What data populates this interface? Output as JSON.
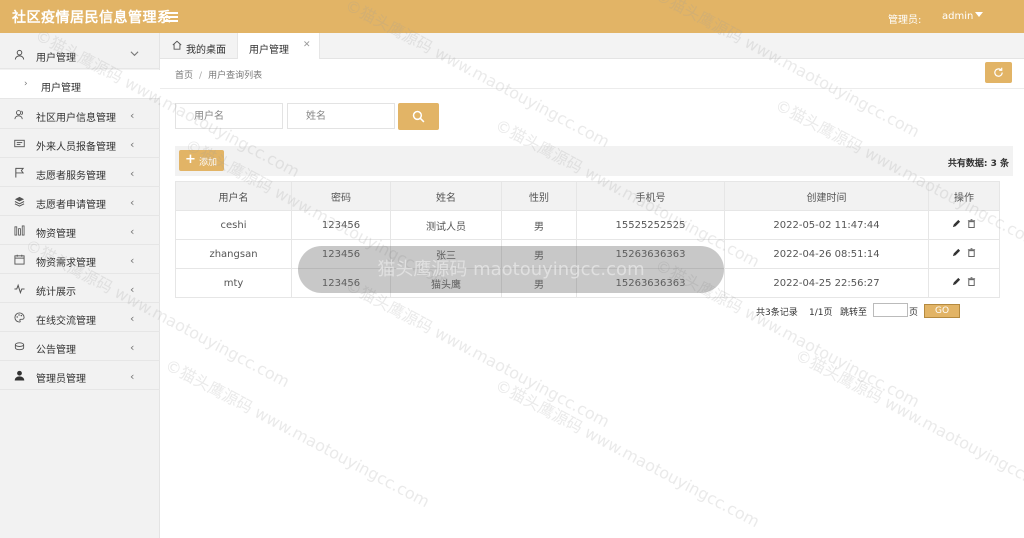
{
  "app": {
    "title": "社区疫情居民信息管理系",
    "admin_label": "管理员:",
    "admin_name": "admin"
  },
  "sidebar": {
    "items": [
      {
        "label": "用户管理",
        "icon": "user-icon",
        "expanded": true
      },
      {
        "label": "社区用户信息管理",
        "icon": "users-icon"
      },
      {
        "label": "外来人员报备管理",
        "icon": "id-card-icon"
      },
      {
        "label": "志愿者服务管理",
        "icon": "flag-icon"
      },
      {
        "label": "志愿者申请管理",
        "icon": "layers-icon"
      },
      {
        "label": "物资管理",
        "icon": "bars-icon"
      },
      {
        "label": "物资需求管理",
        "icon": "calendar-icon"
      },
      {
        "label": "统计展示",
        "icon": "pulse-icon"
      },
      {
        "label": "在线交流管理",
        "icon": "palette-icon"
      },
      {
        "label": "公告管理",
        "icon": "coins-icon"
      },
      {
        "label": "管理员管理",
        "icon": "person-icon"
      }
    ],
    "sub_items": [
      {
        "label": "用户管理"
      }
    ]
  },
  "tabs": {
    "home": "我的桌面",
    "active": "用户管理"
  },
  "breadcrumb": {
    "home": "首页",
    "separator": "/",
    "current": "用户查询列表"
  },
  "search": {
    "username_placeholder": "用户名",
    "name_placeholder": "姓名"
  },
  "toolbar": {
    "add_label": "添加",
    "total_label": "共有数据: 3 条"
  },
  "table": {
    "headers": [
      "用户名",
      "密码",
      "姓名",
      "性别",
      "手机号",
      "创建时间",
      "操作"
    ],
    "rows": [
      [
        "ceshi",
        "123456",
        "测试人员",
        "男",
        "15525252525",
        "2022-05-02 11:47:44"
      ],
      [
        "zhangsan",
        "123456",
        "张三",
        "男",
        "15263636363",
        "2022-04-26 08:51:14"
      ],
      [
        "mty",
        "123456",
        "猫头鹰",
        "男",
        "15263636363",
        "2022-04-25 22:56:27"
      ]
    ]
  },
  "pager": {
    "records": "共3条记录",
    "pages": "1/1页",
    "jump_to": "跳转至",
    "page_unit": "页",
    "go": "GO"
  },
  "watermark": {
    "tile_text": "©猫头鹰源码 www.maotouyingcc.com",
    "banner_text": "猫头鹰源码 maotouyingcc.com"
  },
  "colors": {
    "accent": "#e2b466",
    "sidebar_bg": "#f2f2f2",
    "header_bg": "#f2f2f2"
  }
}
